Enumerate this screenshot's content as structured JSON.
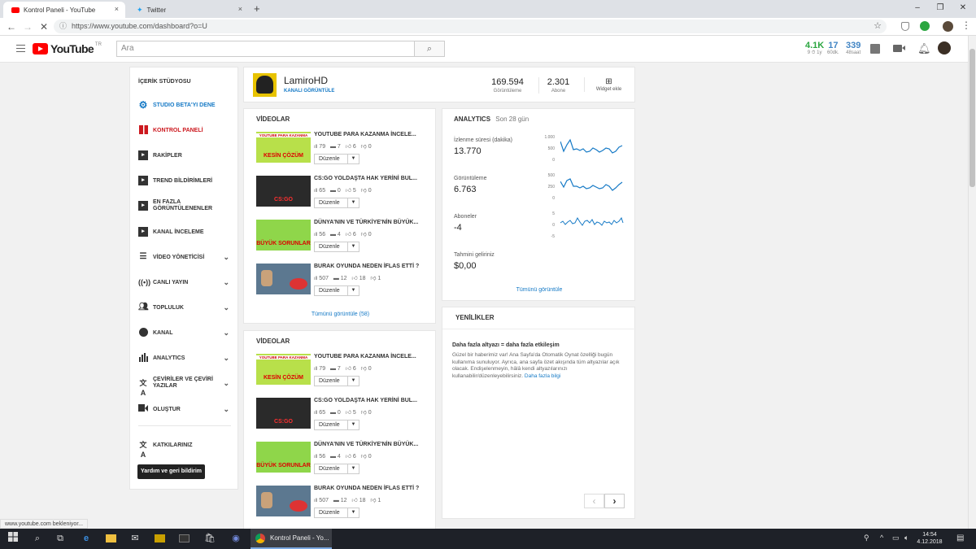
{
  "browser": {
    "tabs": [
      {
        "title": "Kontrol Paneli - YouTube",
        "close": "×"
      },
      {
        "title": "Twitter",
        "close": "×"
      }
    ],
    "new_tab": "+",
    "window_controls": [
      "–",
      "❐",
      "✕"
    ],
    "url": "https://www.youtube.com/dashboard?o=U",
    "status_text": "www.youtube.com bekleniyor..."
  },
  "yt_header": {
    "logo_text": "YouTube",
    "region": "TR",
    "search_placeholder": "Ara",
    "stats": [
      {
        "value": "4.1K",
        "label": "9 ⏱ 1y",
        "color": "#2ba640"
      },
      {
        "value": "17",
        "label": "60dk."
      },
      {
        "value": "339",
        "label": "48saat"
      }
    ]
  },
  "sidebar": {
    "heading": "İÇERİK STÜDYOSU",
    "items": [
      {
        "label": "STUDIO BETA'YI DENE",
        "color": "#167ac6",
        "icon": "gear-icon"
      },
      {
        "label": "KONTROL PANELİ",
        "color": "#cc181e",
        "icon": "dashboard-icon"
      },
      {
        "label": "RAKİPLER",
        "icon": "playlist-icon"
      },
      {
        "label": "TREND BİLDİRİMLERİ",
        "icon": "playlist-icon"
      },
      {
        "label": "EN FAZLA GÖRÜNTÜLENENLER",
        "icon": "playlist-icon"
      },
      {
        "label": "KANAL İNCELEME",
        "icon": "playlist-icon"
      },
      {
        "label": "VİDEO YÖNETİCİSİ",
        "icon": "video-manager-icon",
        "expandable": true
      },
      {
        "label": "CANLI YAYIN",
        "icon": "live-icon",
        "expandable": true
      },
      {
        "label": "TOPLULUK",
        "icon": "people-icon",
        "expandable": true
      },
      {
        "label": "KANAL",
        "icon": "account-icon",
        "expandable": true
      },
      {
        "label": "ANALYTICS",
        "icon": "bar-chart-icon",
        "expandable": true
      },
      {
        "label": "ÇEVİRİLER VE ÇEVİRİ YAZILAR",
        "icon": "translate-icon",
        "expandable": true
      },
      {
        "label": "OLUŞTUR",
        "icon": "camera-icon",
        "expandable": true
      }
    ],
    "contributions": "KATKILARINIZ",
    "help_button": "Yardım ve geri bildirim"
  },
  "channel": {
    "name": "LamiroHD",
    "view_channel": "KANALI GÖRÜNTÜLE",
    "views_value": "169.594",
    "views_label": "Görüntüleme",
    "subs_value": "2.301",
    "subs_label": "Abone",
    "widget_label": "Widget ekle"
  },
  "videos_card_1": {
    "title": "VİDEOLAR",
    "see_all": "Tümünü görüntüle (58)",
    "videos": [
      {
        "title": "YOUTUBE PARA KAZANMA İNCELE...",
        "views": "79",
        "comments": "7",
        "likes": "6",
        "dislikes": "0",
        "action": "Düzenle",
        "thumb_top": "YOUTUBE PARA KAZANMA",
        "thumb_main": "KESİN ÇÖZÜM"
      },
      {
        "title": "CS:GO YOLDAŞTA HAK YERİNİ BUL...",
        "views": "65",
        "comments": "0",
        "likes": "5",
        "dislikes": "0",
        "action": "Düzenle",
        "thumb_main": "CS:GO"
      },
      {
        "title": "DÜNYA'NIN VE TÜRKİYE'NİN BÜYÜK...",
        "views": "56",
        "comments": "4",
        "likes": "6",
        "dislikes": "0",
        "action": "Düzenle",
        "thumb_main": "BÜYÜK SORUNLAR"
      },
      {
        "title": "BURAK OYUNDA NEDEN İFLAS ETTİ ?",
        "views": "507",
        "comments": "12",
        "likes": "18",
        "dislikes": "1",
        "action": "Düzenle"
      }
    ]
  },
  "videos_card_2": {
    "title": "VİDEOLAR",
    "videos": [
      {
        "title": "YOUTUBE PARA KAZANMA İNCELE...",
        "views": "79",
        "comments": "7",
        "likes": "6",
        "dislikes": "0",
        "action": "Düzenle",
        "thumb_top": "YOUTUBE PARA KAZANMA",
        "thumb_main": "KESİN ÇÖZÜM"
      },
      {
        "title": "CS:GO YOLDAŞTA HAK YERİNİ BUL...",
        "views": "65",
        "comments": "0",
        "likes": "5",
        "dislikes": "0",
        "action": "Düzenle",
        "thumb_main": "CS:GO"
      },
      {
        "title": "DÜNYA'NIN VE TÜRKİYE'NİN BÜYÜK...",
        "views": "56",
        "comments": "4",
        "likes": "6",
        "dislikes": "0",
        "action": "Düzenle",
        "thumb_main": "BÜYÜK SORUNLAR"
      },
      {
        "title": "BURAK OYUNDA NEDEN İFLAS ETTİ ?",
        "views": "507",
        "comments": "12",
        "likes": "18",
        "dislikes": "1",
        "action": "Düzenle"
      }
    ]
  },
  "analytics": {
    "title": "ANALYTICS",
    "period": "Son 28 gün",
    "metrics": [
      {
        "label": "İzlenme süresi (dakika)",
        "value": "13.770",
        "ticks": [
          "1.000",
          "500",
          "0"
        ]
      },
      {
        "label": "Görüntüleme",
        "value": "6.763",
        "ticks": [
          "500",
          "250",
          "0"
        ]
      },
      {
        "label": "Aboneler",
        "value": "-4",
        "ticks": [
          "5",
          "0",
          "-5"
        ]
      },
      {
        "label": "Tahmini geliriniz",
        "value": "$0,00"
      }
    ],
    "see_all": "Tümünü görüntüle",
    "line_color": "#167ac6"
  },
  "news": {
    "title": "YENİLİKLER",
    "headline": "Daha fazla altyazı = daha fazla etkileşim",
    "body": "Güzel bir haberimiz var! Ana Sayfa'da Otomatik Oynat özelliği bugün kullanıma sunuluyor. Ayrıca, ana sayfa özet akışında tüm altyazılar açık olacak. Endişelenmeyin, hâlâ kendi altyazılarınızı kullanabilir/düzenleyebilirsiniz.",
    "link": "Daha fazla bilgi",
    "prev": "‹",
    "next": "›"
  },
  "taskbar": {
    "active_window": "Kontrol Paneli - Yo...",
    "time": "14:54",
    "date": "4.12.2018"
  }
}
